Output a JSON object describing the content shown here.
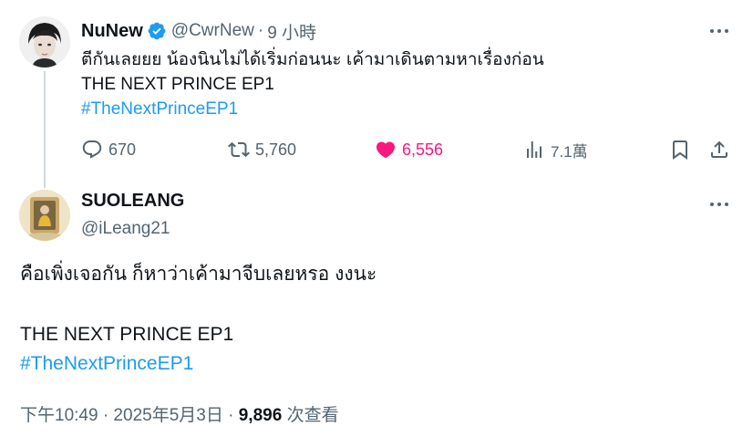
{
  "parent_tweet": {
    "display_name": "NuNew",
    "verified": true,
    "handle": "@CwrNew",
    "separator": "·",
    "time_ago": "9 小時",
    "text_line1": "ตีกันเลยยย น้องนินไม่ได้เริ่มก่อนนะ เค้ามาเดินตามหาเรื่องก่อน",
    "text_line2": "THE NEXT PRINCE EP1",
    "hashtag": "#TheNextPrinceEP1",
    "actions": {
      "replies": "670",
      "reposts": "5,760",
      "likes": "6,556",
      "views": "7.1萬"
    },
    "icons": [
      "verified-badge-icon",
      "reply-icon",
      "repost-icon",
      "heart-icon",
      "analytics-icon",
      "bookmark-icon",
      "share-icon",
      "more-icon"
    ],
    "colors": {
      "verified": "#1d9bf0",
      "like": "#f91880",
      "hashtag": "#1d9bf0",
      "muted": "#536471"
    }
  },
  "reply_tweet": {
    "display_name": "SUOLEANG",
    "handle": "@iLeang21",
    "text_line1": "คือเพิ่งเจอกัน ก็หาว่าเค้ามาจีบเลยหรอ งงนะ",
    "text_line2": "THE NEXT PRINCE EP1",
    "hashtag": "#TheNextPrinceEP1",
    "timestamp": "下午10:49 · 2025年5月3日 ·",
    "views_count": "9,896",
    "views_label": "次查看"
  }
}
